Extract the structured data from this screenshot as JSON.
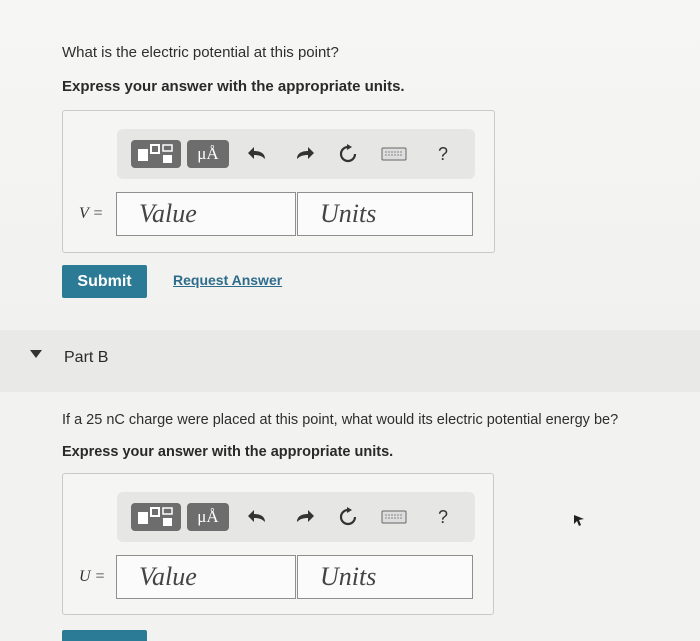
{
  "partA": {
    "question": "What is the electric potential at this point?",
    "instruction": "Express your answer with the appropriate units.",
    "toolbar": {
      "units_label": "μÅ",
      "help_label": "?"
    },
    "variable": "V =",
    "value_placeholder": "Value",
    "units_placeholder": "Units",
    "submit_label": "Submit",
    "request_label": "Request Answer"
  },
  "partB": {
    "title": "Part B",
    "question": "If a 25 nC charge were placed at this point, what would its electric potential energy be?",
    "instruction": "Express your answer with the appropriate units.",
    "toolbar": {
      "units_label": "μÅ",
      "help_label": "?"
    },
    "variable": "U =",
    "value_placeholder": "Value",
    "units_placeholder": "Units"
  },
  "colors": {
    "accent": "#2b7a96",
    "link": "#2e6c8c",
    "toolbar_button": "#6d6d6d"
  },
  "icons": [
    "templates-icon",
    "units-icon",
    "undo-icon",
    "redo-icon",
    "reset-icon",
    "keyboard-icon",
    "help-icon",
    "collapse-triangle-icon",
    "cursor-icon"
  ]
}
